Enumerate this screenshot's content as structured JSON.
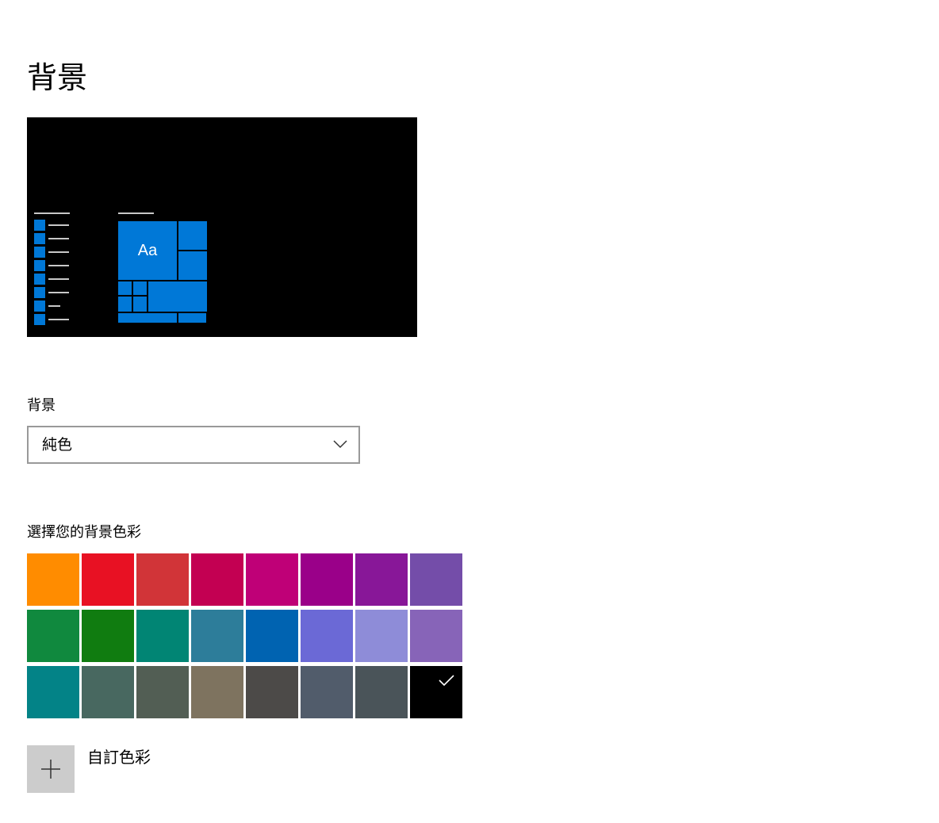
{
  "page": {
    "title": "背景"
  },
  "preview": {
    "tile_text": "Aa",
    "accent_color": "#0078d7",
    "background_color": "#000000"
  },
  "background": {
    "label": "背景",
    "dropdown_value": "純色"
  },
  "colors": {
    "label": "選擇您的背景色彩",
    "swatches": [
      "#ff8c00",
      "#e81123",
      "#d13438",
      "#c30052",
      "#bf0077",
      "#9a0089",
      "#881798",
      "#744da9",
      "#10893e",
      "#107c10",
      "#018574",
      "#2d7d9a",
      "#0063b1",
      "#6b69d6",
      "#8e8cd8",
      "#8764b8",
      "#038387",
      "#486860",
      "#525e54",
      "#7e735f",
      "#4c4a48",
      "#515c6b",
      "#4a5459",
      "#000000"
    ],
    "selected_index": 23
  },
  "custom": {
    "label": "自訂色彩",
    "button_icon": "plus-icon"
  }
}
